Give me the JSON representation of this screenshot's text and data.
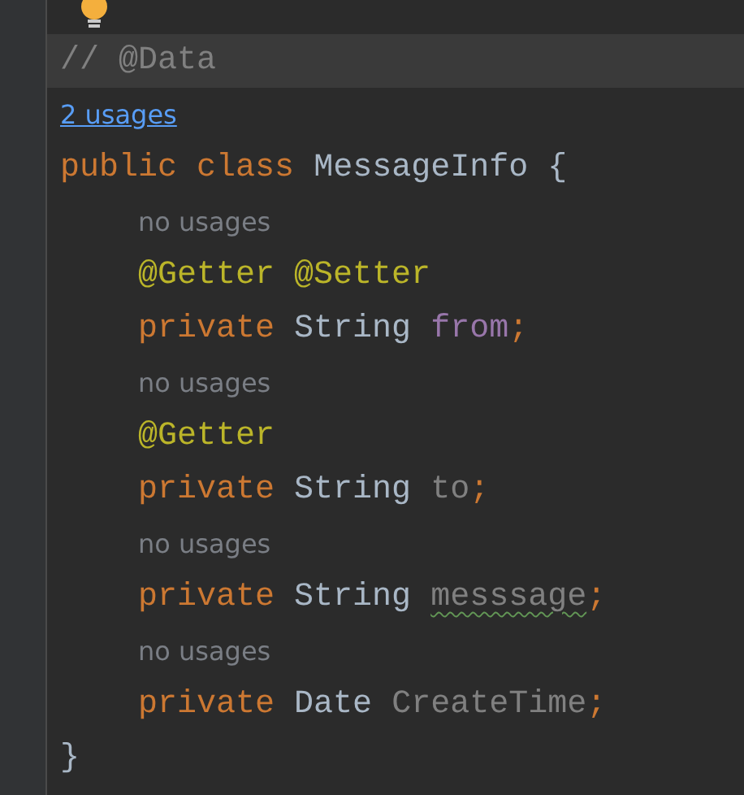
{
  "editor": {
    "lines": [
      {
        "kind": "code",
        "current": true,
        "tokens": [
          {
            "kind": "comment",
            "text": "// @Data"
          }
        ]
      },
      {
        "kind": "usages-link",
        "current": false,
        "text": "2 usages"
      },
      {
        "kind": "code",
        "current": false,
        "tokens": [
          {
            "kind": "keyword",
            "text": "public"
          },
          {
            "kind": "keyword",
            "text": "class"
          },
          {
            "kind": "type",
            "text": "MessageInfo"
          },
          {
            "kind": "brace",
            "text": "{"
          }
        ],
        "children": [
          {
            "kind": "hint",
            "current": false,
            "text": "no usages"
          },
          {
            "kind": "code",
            "current": false,
            "tokens": [
              {
                "kind": "annotation",
                "text": "@Getter"
              },
              {
                "kind": "annotation",
                "text": "@Setter"
              }
            ]
          },
          {
            "kind": "code",
            "current": false,
            "tokens": [
              {
                "kind": "keyword",
                "text": "private"
              },
              {
                "kind": "type",
                "text": "String"
              },
              {
                "kind": "field",
                "text": "from",
                "typo": false
              },
              {
                "kind": "punct",
                "text": ";"
              }
            ]
          },
          {
            "kind": "hint",
            "current": false,
            "text": "no usages"
          },
          {
            "kind": "code",
            "current": false,
            "tokens": [
              {
                "kind": "annotation",
                "text": "@Getter"
              }
            ]
          },
          {
            "kind": "code",
            "current": false,
            "tokens": [
              {
                "kind": "keyword",
                "text": "private"
              },
              {
                "kind": "type",
                "text": "String"
              },
              {
                "kind": "unused",
                "text": "to",
                "typo": false
              },
              {
                "kind": "punct",
                "text": ";"
              }
            ]
          },
          {
            "kind": "hint",
            "current": false,
            "text": "no usages"
          },
          {
            "kind": "code",
            "current": false,
            "tokens": [
              {
                "kind": "keyword",
                "text": "private"
              },
              {
                "kind": "type",
                "text": "String"
              },
              {
                "kind": "unused",
                "text": "messsage",
                "typo": true
              },
              {
                "kind": "punct",
                "text": ";"
              }
            ]
          },
          {
            "kind": "hint",
            "current": false,
            "text": "no usages"
          },
          {
            "kind": "code",
            "current": false,
            "tokens": [
              {
                "kind": "keyword",
                "text": "private"
              },
              {
                "kind": "type",
                "text": "Date"
              },
              {
                "kind": "unused",
                "text": "CreateTime",
                "typo": false
              },
              {
                "kind": "punct",
                "text": ";"
              }
            ]
          }
        ]
      },
      {
        "kind": "code",
        "current": false,
        "tokens": [
          {
            "kind": "brace",
            "text": "}"
          }
        ]
      }
    ]
  }
}
